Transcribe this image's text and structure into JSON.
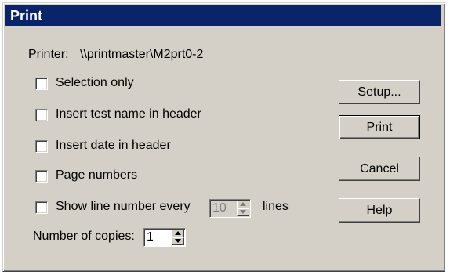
{
  "dialog": {
    "title": "Print",
    "printer_label": "Printer:",
    "printer_value": "\\\\printmaster\\M2prt0-2"
  },
  "options": [
    {
      "label": "Selection only",
      "checked": false
    },
    {
      "label": "Insert test name in header",
      "checked": false
    },
    {
      "label": "Insert date in header",
      "checked": false
    },
    {
      "label": "Page numbers",
      "checked": false
    },
    {
      "label": "Show line number every",
      "checked": false
    }
  ],
  "line_interval": {
    "value": "10",
    "unit_label": "lines",
    "enabled": false
  },
  "copies": {
    "label": "Number of copies:",
    "value": "1"
  },
  "buttons": {
    "setup": "Setup...",
    "print": "Print",
    "cancel": "Cancel",
    "help": "Help"
  },
  "colors": {
    "titlebar": "#0a246a",
    "dialog_bg": "#d4d0c8"
  }
}
